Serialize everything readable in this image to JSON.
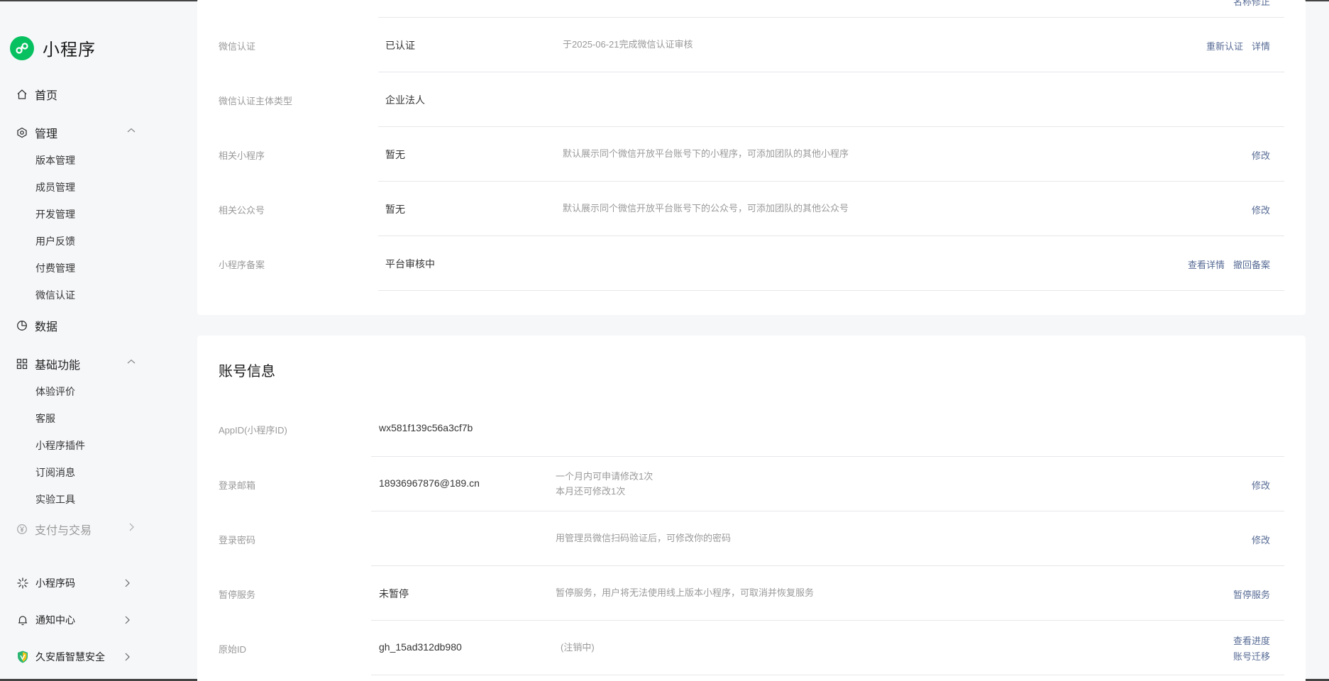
{
  "app": {
    "logo_text": "小程序"
  },
  "sidebar": {
    "home": "首页",
    "manage": {
      "label": "管理",
      "items": [
        "版本管理",
        "成员管理",
        "开发管理",
        "用户反馈",
        "付费管理",
        "微信认证"
      ]
    },
    "data": "数据",
    "basic": {
      "label": "基础功能",
      "items": [
        "体验评价",
        "客服",
        "小程序插件",
        "订阅消息",
        "实验工具"
      ]
    },
    "payment": "支付与交易",
    "bottom": [
      {
        "label": "小程序码",
        "icon": "sparkle-icon"
      },
      {
        "label": "通知中心",
        "icon": "bell-icon"
      },
      {
        "label": "久安盾智慧安全",
        "icon": "shield-icon"
      }
    ]
  },
  "top_card": {
    "cut_action": "名称修正",
    "rows": [
      {
        "label": "微信认证",
        "value": "已认证",
        "desc": "于2025-06-21完成微信认证审核",
        "actions": [
          "重新认证",
          "详情"
        ]
      },
      {
        "label": "微信认证主体类型",
        "value": "企业法人",
        "desc": "",
        "actions": []
      },
      {
        "label": "相关小程序",
        "value": "暂无",
        "desc": "默认展示同个微信开放平台账号下的小程序，可添加团队的其他小程序",
        "actions": [
          "修改"
        ]
      },
      {
        "label": "相关公众号",
        "value": "暂无",
        "desc": "默认展示同个微信开放平台账号下的公众号，可添加团队的其他公众号",
        "actions": [
          "修改"
        ]
      },
      {
        "label": "小程序备案",
        "value": "平台审核中",
        "desc": "",
        "actions": [
          "查看详情",
          "撤回备案"
        ]
      }
    ]
  },
  "account_card": {
    "title": "账号信息",
    "rows": [
      {
        "label": "AppID(小程序ID)",
        "value": "wx581f139c56a3cf7b",
        "desc": "",
        "desc2": "",
        "actions": []
      },
      {
        "label": "登录邮箱",
        "value": "18936967876@189.cn",
        "desc": "一个月内可申请修改1次",
        "desc2": "本月还可修改1次",
        "actions": [
          "修改"
        ]
      },
      {
        "label": "登录密码",
        "value": "",
        "desc": "用管理员微信扫码验证后，可修改你的密码",
        "desc2": "",
        "actions": [
          "修改"
        ]
      },
      {
        "label": "暂停服务",
        "value": "未暂停",
        "desc": "暂停服务，用户将无法使用线上版本小程序，可取消并恢复服务",
        "desc2": "",
        "actions": [
          "暂停服务"
        ]
      },
      {
        "label": "原始ID",
        "value": "gh_15ad312db980",
        "desc": "(注销中)",
        "desc2": "",
        "actions": [
          "查看进度",
          "账号迁移"
        ]
      }
    ]
  },
  "colors": {
    "link": "#576b95",
    "brand": "#07c160",
    "label": "#9a9a9a"
  }
}
